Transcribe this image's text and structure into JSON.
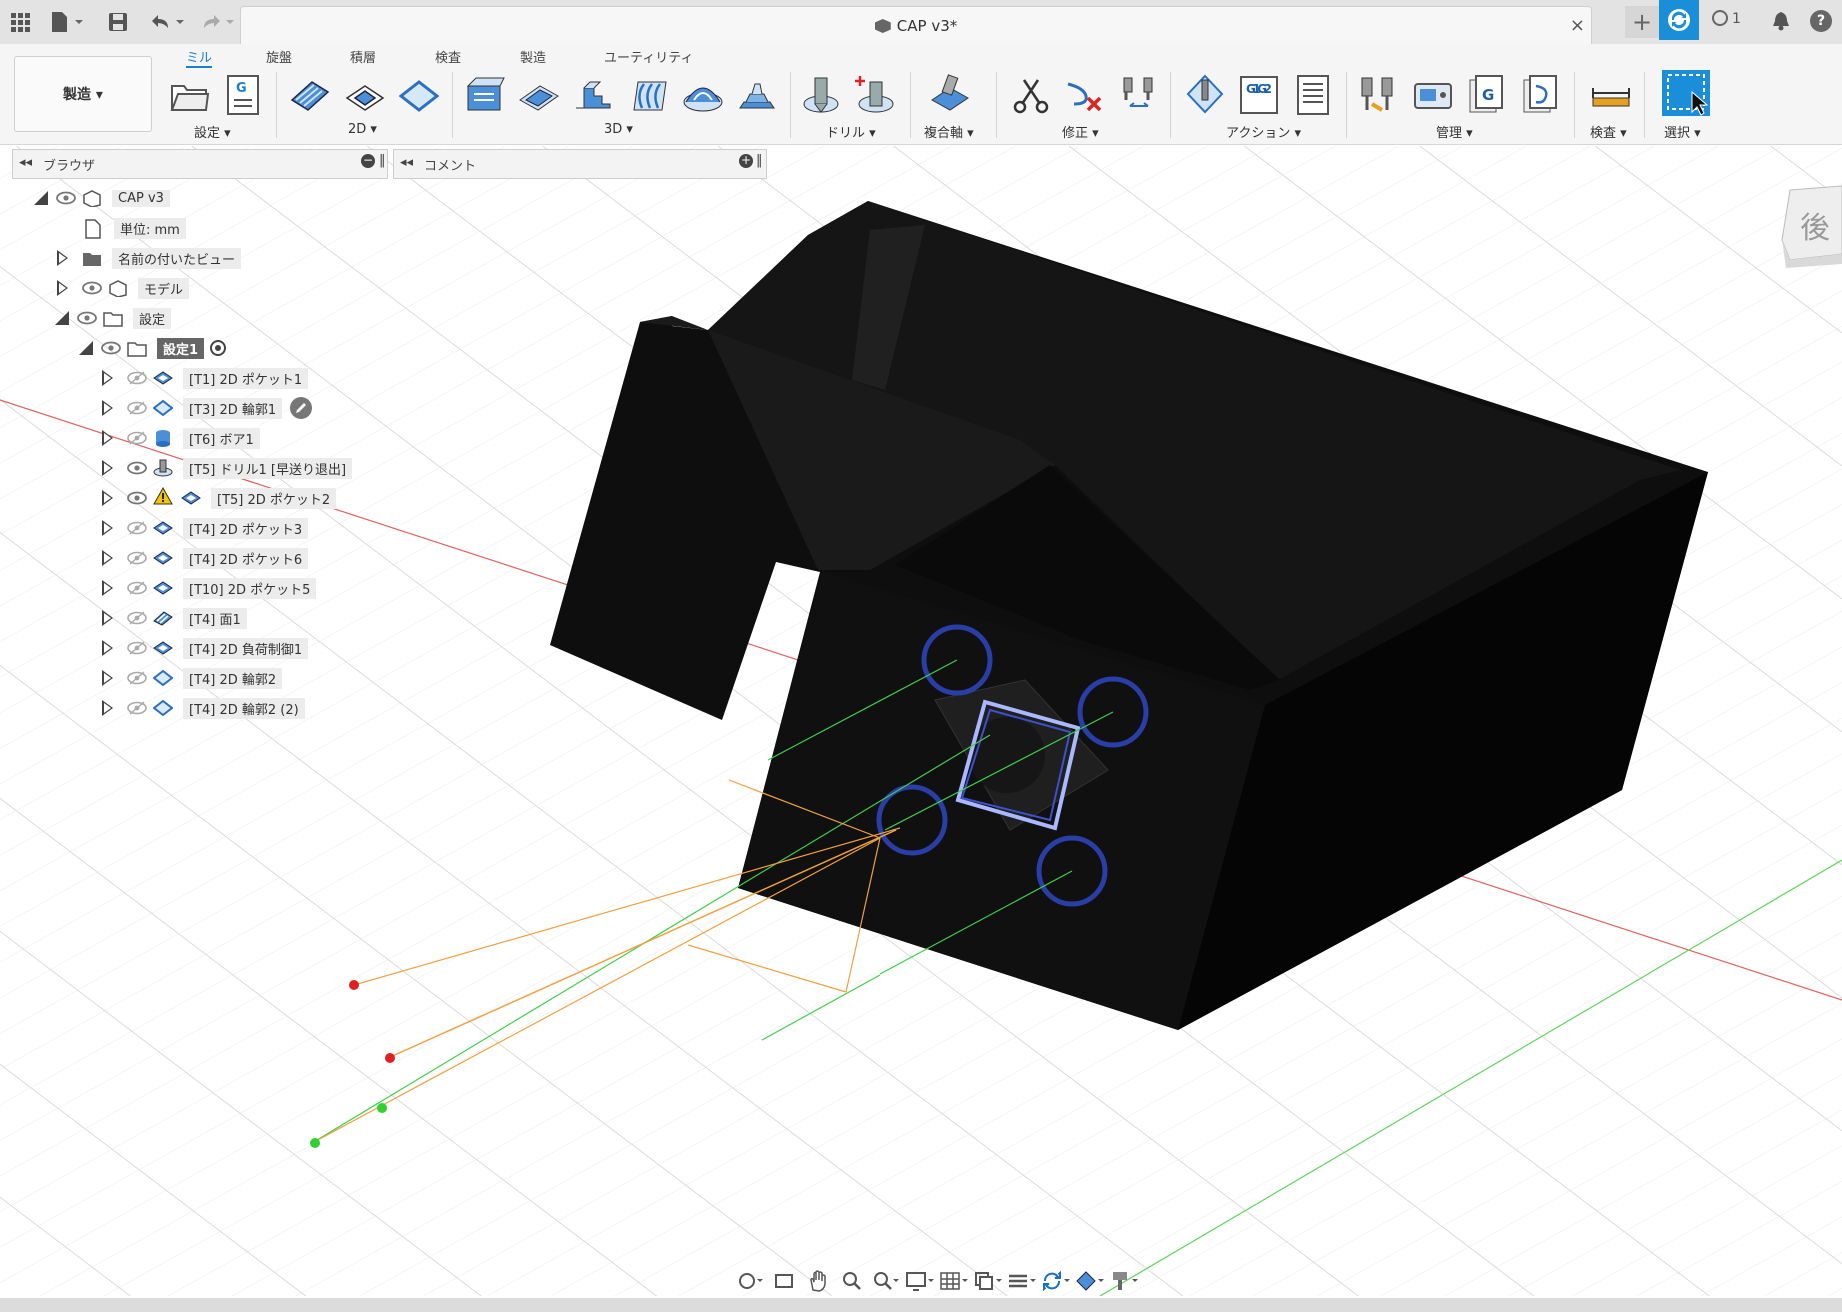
{
  "title_bar": {
    "document_title": "CAP v3*",
    "job_count": "1",
    "help_label": "?",
    "close_label": "×"
  },
  "ribbon": {
    "workspace_label": "製造 ▾",
    "tabs": [
      {
        "label": "ミル",
        "active": true
      },
      {
        "label": "旋盤"
      },
      {
        "label": "積層"
      },
      {
        "label": "検査"
      },
      {
        "label": "製造"
      },
      {
        "label": "ユーティリティ"
      }
    ],
    "groups": {
      "setup": "設定 ▾",
      "two_d": "2D ▾",
      "three_d": "3D ▾",
      "drill": "ドリル ▾",
      "multiaxis": "複合軸 ▾",
      "modify": "修正 ▾",
      "actions": "アクション ▾",
      "manage": "管理 ▾",
      "inspect": "検査 ▾",
      "select": "選択 ▾"
    },
    "g1g2_label": "G1G2"
  },
  "panels": {
    "browser_title": "ブラウザ",
    "comments_title": "コメント"
  },
  "browser": {
    "root": "CAP v3",
    "units": "単位: mm",
    "named_views": "名前の付いたビュー",
    "model": "モデル",
    "setups": "設定",
    "setup1": "設定1",
    "operations": [
      {
        "label": "[T1] 2D ポケット1",
        "icon": "pocket-icon"
      },
      {
        "label": "[T3] 2D 輪郭1",
        "icon": "contour-icon"
      },
      {
        "label": "[T6] ボア1",
        "icon": "bore-icon"
      },
      {
        "label": "[T5] ドリル1 [早送り退出]",
        "icon": "drill-icon"
      },
      {
        "label": "[T5] 2D ポケット2",
        "icon": "pocket-icon",
        "warning": true
      },
      {
        "label": "[T4] 2D ポケット3",
        "icon": "pocket-icon"
      },
      {
        "label": "[T4] 2D ポケット6",
        "icon": "pocket-icon"
      },
      {
        "label": "[T10] 2D ポケット5",
        "icon": "pocket-icon"
      },
      {
        "label": "[T4] 面1",
        "icon": "face-icon"
      },
      {
        "label": "[T4] 2D 負荷制御1",
        "icon": "pocket-icon"
      },
      {
        "label": "[T4] 2D 輪郭2",
        "icon": "contour-icon"
      },
      {
        "label": "[T4] 2D 輪郭2 (2)",
        "icon": "contour-icon"
      }
    ]
  },
  "viewcube_label": "後",
  "colors": {
    "accent": "#1a8ed8",
    "model": "#0c0c0c",
    "toolpath_green": "#3fcf4a",
    "toolpath_orange": "#f0a040",
    "axis_red": "#e04040",
    "hole_blue": "#2a3ea8"
  }
}
